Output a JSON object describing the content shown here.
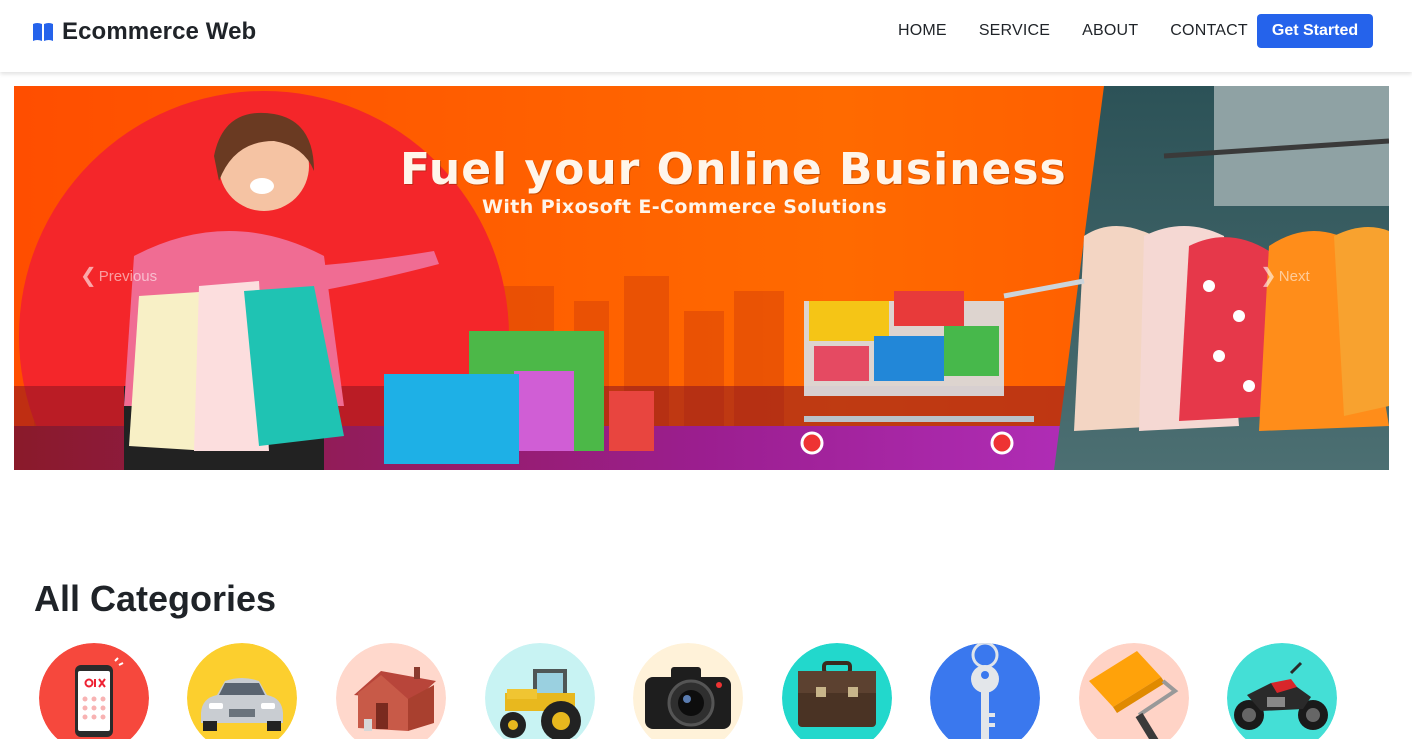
{
  "nav": {
    "brand": "Ecommerce Web",
    "brand_icon": "open-book-icon",
    "links": [
      "HOME",
      "SERVICE",
      "ABOUT",
      "CONTACT"
    ],
    "cta": "Get Started",
    "accent": "#2563eb"
  },
  "banner": {
    "headline": "Fuel your Online Business",
    "subheadline": "With Pixosoft E-Commerce Solutions",
    "prev_label": "Previous",
    "next_label": "Next",
    "colors": {
      "orange": "#ff5a00",
      "red_circle": "#f22a2a",
      "purple": "#a020c8"
    }
  },
  "categories": {
    "title": "All Categories",
    "items": [
      {
        "icon": "phone-icon",
        "bg": "#f6483d"
      },
      {
        "icon": "car-icon",
        "bg": "#fccf2e"
      },
      {
        "icon": "house-icon",
        "bg": "#ffd8cc"
      },
      {
        "icon": "tractor-icon",
        "bg": "#c8f3f3"
      },
      {
        "icon": "camera-icon",
        "bg": "#fff2d9"
      },
      {
        "icon": "briefcase-icon",
        "bg": "#22d8cc"
      },
      {
        "icon": "key-icon",
        "bg": "#3a78ee"
      },
      {
        "icon": "paint-roller-icon",
        "bg": "#ffd3c6"
      },
      {
        "icon": "motorcycle-icon",
        "bg": "#44dfd6"
      }
    ]
  }
}
